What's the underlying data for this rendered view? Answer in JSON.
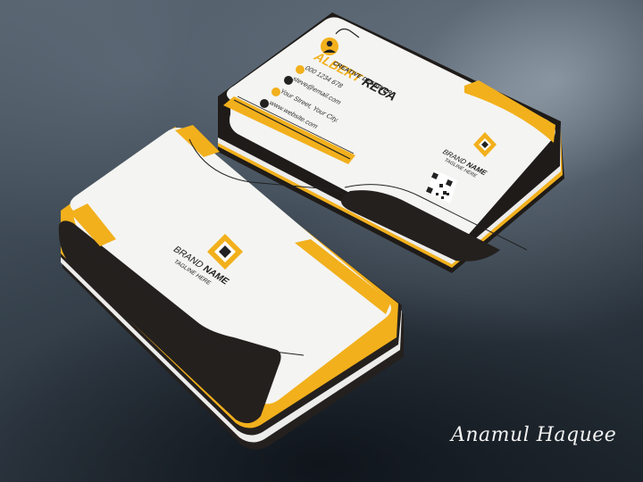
{
  "colors": {
    "accent": "#f2b01c",
    "card_white": "#f4f4f2",
    "card_dark": "#24201e",
    "background": "#3a4550"
  },
  "back_card": {
    "name_first": "ALBERT",
    "name_last": "REGA",
    "role": "CREATIVE DESIGNER",
    "phone": "000 1234 678",
    "email": "steve@email.com",
    "address": "Your Street, Your City.",
    "website": "www.website.com",
    "brand_first": "BRAND",
    "brand_last": "NAME",
    "tagline": "TAGLINE HERE",
    "icons": [
      "user-icon",
      "phone-icon",
      "email-icon",
      "location-icon",
      "globe-icon",
      "qr-code-icon",
      "diamond-logo-icon"
    ]
  },
  "front_card": {
    "brand_first": "BRAND",
    "brand_last": "NAME",
    "tagline": "TAGLINE HERE",
    "icons": [
      "diamond-logo-icon"
    ]
  },
  "signature": "Anamul Haquee"
}
